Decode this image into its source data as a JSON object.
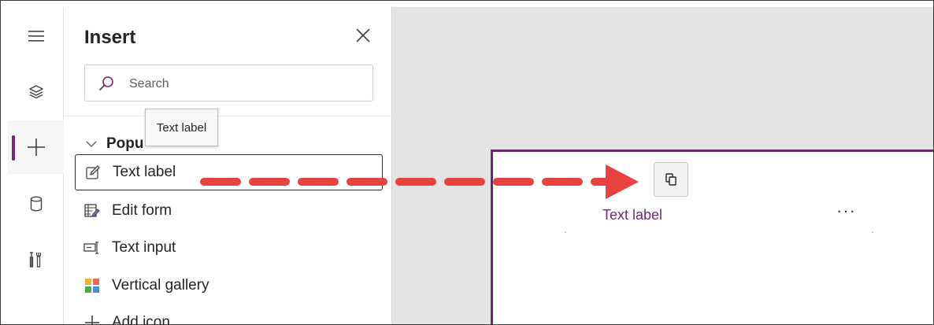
{
  "rail": {
    "items": [
      {
        "icon": "hamburger-menu-icon"
      },
      {
        "icon": "layers-icon"
      },
      {
        "icon": "plus-icon",
        "active": true
      },
      {
        "icon": "database-icon"
      },
      {
        "icon": "tools-icon"
      }
    ]
  },
  "insert_pane": {
    "title": "Insert",
    "close_icon": "close-icon",
    "search": {
      "placeholder": "Search",
      "icon": "search-icon"
    },
    "section": {
      "label": "Popu",
      "icon": "chevron-down-icon"
    },
    "items": [
      {
        "label": "Text label",
        "icon": "pencil-edit-icon",
        "selected": true
      },
      {
        "label": "Edit form",
        "icon": "form-edit-icon"
      },
      {
        "label": "Text input",
        "icon": "text-input-icon"
      },
      {
        "label": "Vertical gallery",
        "icon": "gallery-grid-icon"
      },
      {
        "label": "Add icon",
        "icon": "plus-icon"
      }
    ]
  },
  "tooltip": {
    "text": "Text label"
  },
  "canvas": {
    "drop_preview_icon": "copy-icon",
    "drop_label": "Text label",
    "more_options": "···"
  },
  "colors": {
    "accent": "#742774",
    "screen_border": "#6b2770",
    "arrow": "#e8423f",
    "canvas_bg": "#e4e4e4"
  }
}
